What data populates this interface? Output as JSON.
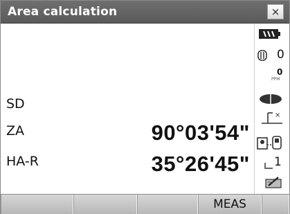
{
  "window": {
    "title": "Area calculation",
    "close_label": "×"
  },
  "measurements": [
    {
      "label": "SD",
      "value": ""
    },
    {
      "label": "ZA",
      "value": "90°03'54\""
    },
    {
      "label": "HA-R",
      "value": "35°26'45\""
    }
  ],
  "status": {
    "battery_icon": "battery-icon",
    "prism_constant": "0",
    "ppm_value": "0",
    "ppm_label": "PPM",
    "target_icon": "prism-target-icon",
    "tilt_icon": "tilt-compensation-icon",
    "comm_icon": "communication-icon",
    "page_number": "1",
    "input_mode_icon": "input-mode-icon"
  },
  "softkeys": [
    "",
    "",
    "",
    "MEAS",
    ""
  ]
}
